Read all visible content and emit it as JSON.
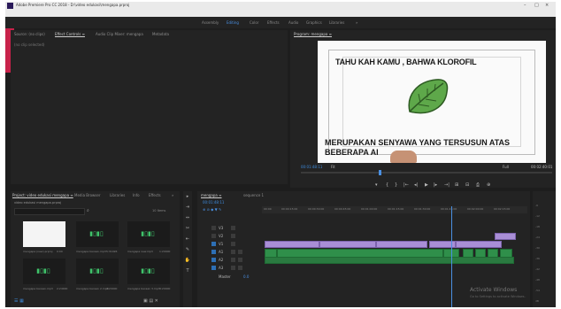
{
  "titlebar": {
    "title": "Adobe Premiere Pro CC 2018 - D:\\video edukasi\\mengapa.prproj",
    "controls": [
      "–",
      "□",
      "×"
    ]
  },
  "menu": [
    "File",
    "Edit",
    "Clip",
    "Sequence",
    "Markers",
    "Graphics",
    "Window",
    "Help"
  ],
  "workspaces": {
    "items": [
      "Assembly",
      "Editing",
      "Color",
      "Effects",
      "Audio",
      "Graphics",
      "Libraries"
    ],
    "active_index": 1,
    "more": "»"
  },
  "source_panel": {
    "tabs": [
      "Source: (no clips)",
      "Effect Controls ≡",
      "Audio Clip Mixer: mengapa",
      "Metadata"
    ],
    "selection_label": "(no clip selected)"
  },
  "program_monitor": {
    "tab": "Program: mengapa ≡",
    "video_title": "TAHU KAH KAMU , BAHWA KLOROFIL",
    "video_caption": "MERUPAKAN SENYAWA YANG TERSUSUN ATAS BEBERAPA AI",
    "timecode_left": "00:01:48:11",
    "fit": "Fit",
    "fraction": "Full",
    "timecode_right": "00:02:40:01",
    "controls": [
      "▾",
      "{",
      "}",
      "|←",
      "◂|",
      "▶",
      "|▸",
      "→|",
      "⊞",
      "⊟",
      "⎙",
      "⊕"
    ]
  },
  "project_panel": {
    "tabs": [
      "Project: video edukasi mengapa ≡",
      "Media Browser",
      "Libraries",
      "Info",
      "Effects",
      "»"
    ],
    "path": "video edukasi mengapa.prproj",
    "items_count": "10 Items",
    "search_placeholder": "",
    "items": [
      {
        "name": "mengapa (new).prproj",
        "duration": "0:00",
        "kind": "image"
      },
      {
        "name": "mengapa bacaan.mp3",
        "duration": "5:31026",
        "kind": "audio"
      },
      {
        "name": "mengapa new.mp3",
        "duration": "1:20000",
        "kind": "audio"
      },
      {
        "name": "mengapa bacaan.mp3",
        "duration": "2:24000",
        "kind": "audio"
      },
      {
        "name": "mengapa bacaan 2.mp3",
        "duration": "4:20000",
        "kind": "audio"
      },
      {
        "name": "mengapa bacaan 3.mp3",
        "duration": "3:20000",
        "kind": "audio"
      }
    ]
  },
  "tools": [
    "▸",
    "⇥",
    "⇔",
    "✂",
    "⇤",
    "✎",
    "✋",
    "T"
  ],
  "timeline": {
    "tabs": [
      "mengapa ≡",
      "sequence 1"
    ],
    "timecode": "00:01:48:11",
    "ruler": [
      "00:00",
      "00:00:15:00",
      "00:00:30:00",
      "00:00:45:00",
      "00:01:00:00",
      "00:01:15:00",
      "00:01:30:00",
      "00:01:45:00",
      "00:02:00:00",
      "00:02:15:00"
    ],
    "tracks": [
      "V3",
      "V2",
      "V1",
      "A1",
      "A2",
      "A3",
      "Master"
    ],
    "master_value": "0.0"
  },
  "meter": {
    "ticks": [
      "-6",
      "-12",
      "-18",
      "-24",
      "-30",
      "-36",
      "-42",
      "-48",
      "-54",
      "dB"
    ]
  },
  "watermark": {
    "title": "Activate Windows",
    "sub": "Go to Settings to activate Windows."
  }
}
